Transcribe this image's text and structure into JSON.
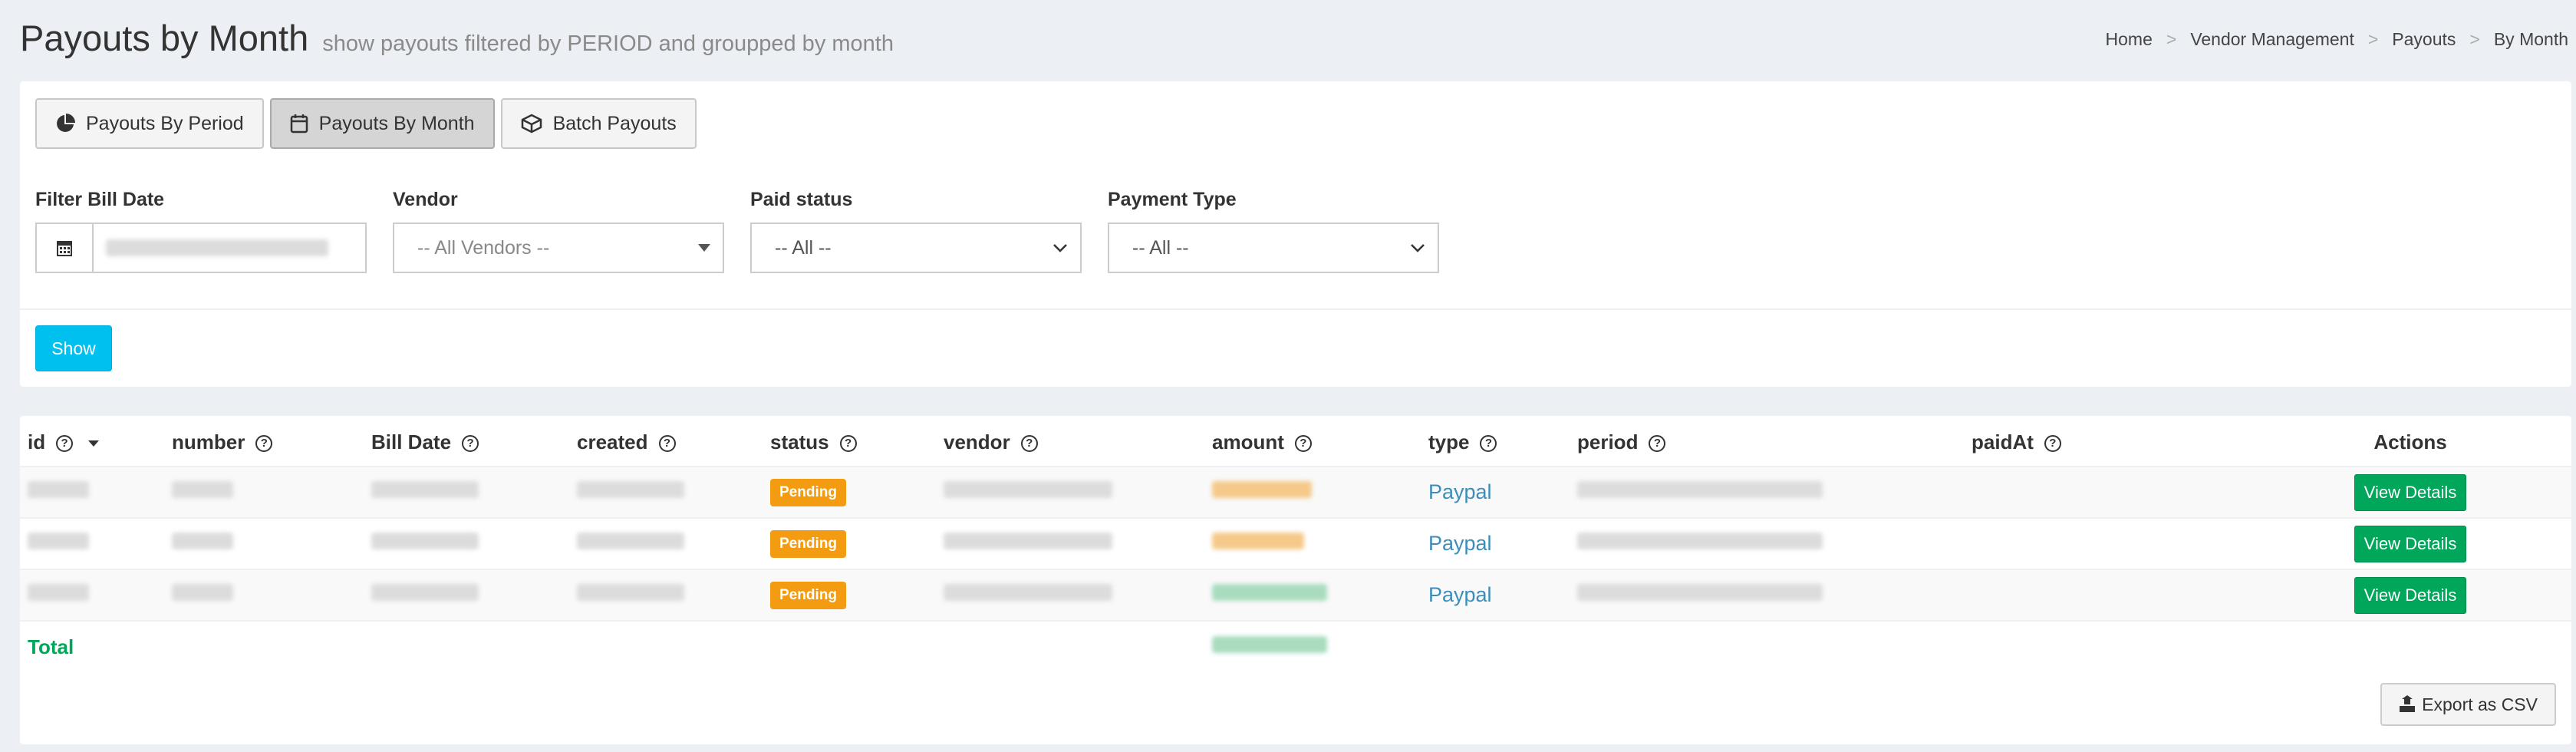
{
  "header": {
    "title": "Payouts by Month",
    "subtitle": "show payouts filtered by PERIOD and groupped by month"
  },
  "breadcrumb": [
    "Home",
    "Vendor Management",
    "Payouts",
    "By Month"
  ],
  "tabs": [
    {
      "label": "Payouts By Period",
      "icon": "pie-chart-icon",
      "active": false
    },
    {
      "label": "Payouts By Month",
      "icon": "calendar-icon",
      "active": true
    },
    {
      "label": "Batch Payouts",
      "icon": "cube-icon",
      "active": false
    }
  ],
  "filters": {
    "bill_date_label": "Filter Bill Date",
    "vendor_label": "Vendor",
    "vendor_value": "-- All Vendors --",
    "paid_status_label": "Paid status",
    "paid_status_value": "-- All --",
    "payment_type_label": "Payment Type",
    "payment_type_value": "-- All --"
  },
  "show_button": "Show",
  "table": {
    "columns": [
      "id",
      "number",
      "Bill Date",
      "created",
      "status",
      "vendor",
      "amount",
      "type",
      "period",
      "paidAt",
      "Actions"
    ],
    "rows": [
      {
        "status": "Pending",
        "type": "Paypal",
        "action": "View Details",
        "amount_color": "#f39c12"
      },
      {
        "status": "Pending",
        "type": "Paypal",
        "action": "View Details",
        "amount_color": "#f39c12"
      },
      {
        "status": "Pending",
        "type": "Paypal",
        "action": "View Details",
        "amount_color": "#00a65a"
      }
    ],
    "total_label": "Total"
  },
  "export_button": "Export as CSV",
  "colors": {
    "accent_blue": "#00c0ef",
    "success_green": "#00a65a",
    "warning_orange": "#f39c12",
    "link_blue": "#3c8dbc"
  }
}
